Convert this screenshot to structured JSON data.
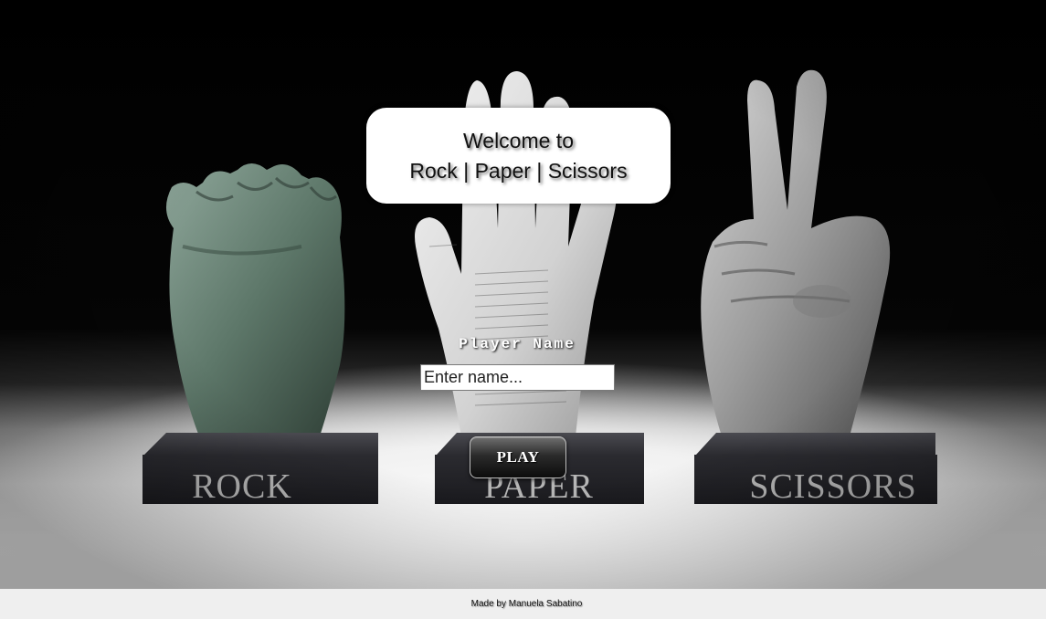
{
  "welcome": {
    "line1": "Welcome to",
    "line2": "Rock | Paper | Scissors"
  },
  "form": {
    "player_label": "Player Name",
    "name_placeholder": "Enter name...",
    "play_label": "PLAY"
  },
  "background": {
    "plinths": [
      "ROCK",
      "PAPER",
      "SCISSORS"
    ]
  },
  "footer": {
    "credit": "Made by Manuela Sabatino"
  },
  "colors": {
    "stage_top": "#000000",
    "floor": "#f3f3f3",
    "rock_hand": "#5f7a6c",
    "paper_hand": "#d9d9d9",
    "scissors_hand": "#9a9a9a",
    "plinth": "#2a2a2e"
  }
}
